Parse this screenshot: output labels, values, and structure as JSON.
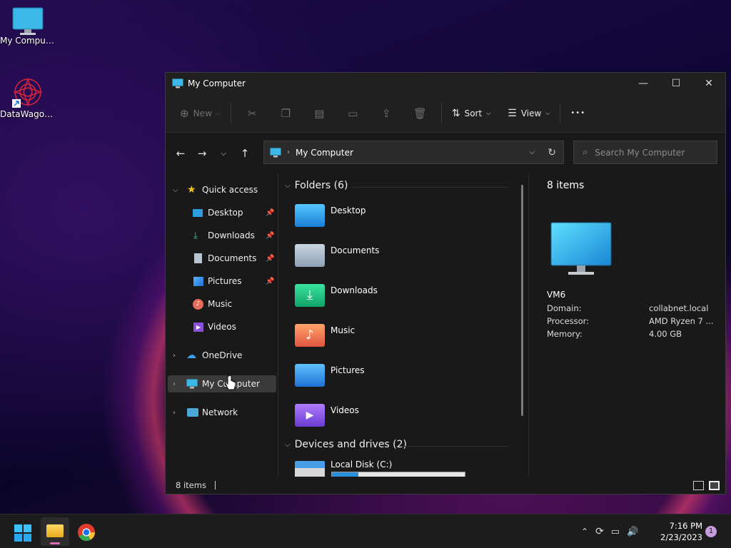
{
  "desktop": {
    "icons": [
      {
        "label": "My Computer"
      },
      {
        "label": "DataWagon..."
      }
    ]
  },
  "window": {
    "title": "My Computer",
    "controls": {
      "minimize": "—",
      "maximize": "☐",
      "close": "✕"
    }
  },
  "toolbar": {
    "new_label": "New",
    "sort_label": "Sort",
    "view_label": "View",
    "more_label": "•••"
  },
  "address": {
    "path": "My Computer",
    "search_placeholder": "Search My Computer"
  },
  "sidebar": {
    "quick_access": "Quick access",
    "items": [
      {
        "label": "Desktop"
      },
      {
        "label": "Downloads"
      },
      {
        "label": "Documents"
      },
      {
        "label": "Pictures"
      },
      {
        "label": "Music"
      },
      {
        "label": "Videos"
      }
    ],
    "onedrive": "OneDrive",
    "my_computer": "My Computer",
    "network": "Network"
  },
  "main": {
    "folders_group": "Folders (6)",
    "folders": [
      {
        "name": "Desktop"
      },
      {
        "name": "Documents"
      },
      {
        "name": "Downloads"
      },
      {
        "name": "Music"
      },
      {
        "name": "Pictures"
      },
      {
        "name": "Videos"
      }
    ],
    "devices_group": "Devices and drives (2)",
    "drive": {
      "name": "Local Disk (C:)",
      "used_fraction": 0.2
    }
  },
  "details": {
    "count": "8 items",
    "name": "VM6",
    "domain_label": "Domain:",
    "domain_value": "collabnet.local",
    "processor_label": "Processor:",
    "processor_value": "AMD Ryzen 7 ...",
    "memory_label": "Memory:",
    "memory_value": "4.00 GB"
  },
  "status": {
    "count": "8 items"
  },
  "taskbar": {
    "time": "7:16 PM",
    "date": "2/23/2023",
    "notifications": "1"
  },
  "colors": {
    "accent": "#1e90d8",
    "selection": "#3a3a3a"
  }
}
